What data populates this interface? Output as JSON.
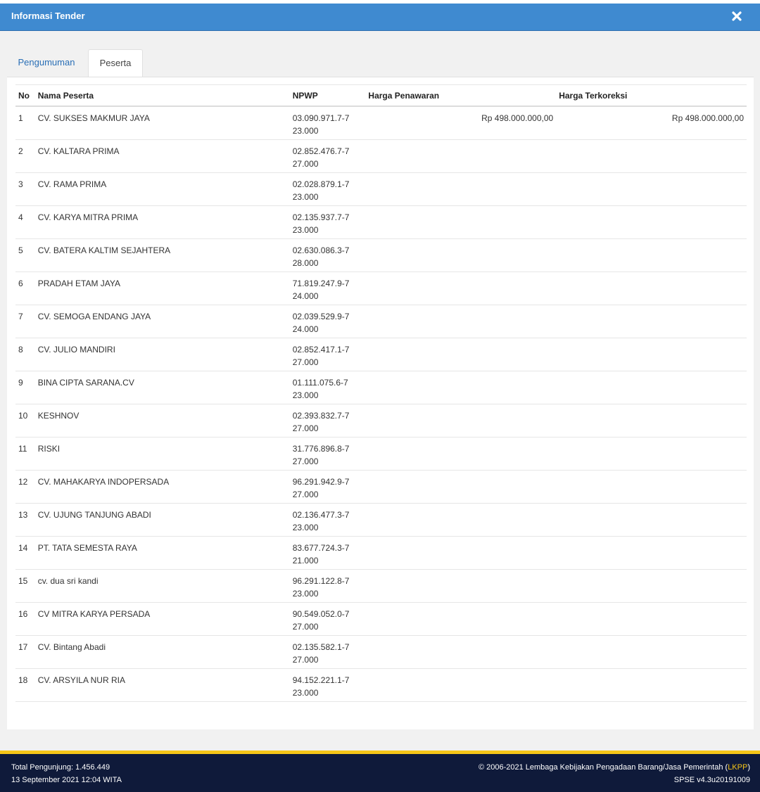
{
  "header": {
    "title": "Informasi Tender"
  },
  "tabs": [
    {
      "label": "Pengumuman",
      "active": false
    },
    {
      "label": "Peserta",
      "active": true
    }
  ],
  "table": {
    "columns": [
      "No",
      "Nama Peserta",
      "NPWP",
      "Harga Penawaran",
      "Harga Terkoreksi"
    ],
    "rows": [
      {
        "no": "1",
        "name": "CV. SUKSES MAKMUR JAYA",
        "npwp": "03.090.971.7-723.000",
        "harga": "Rp 498.000.000,00",
        "terkoreksi": "Rp 498.000.000,00"
      },
      {
        "no": "2",
        "name": "CV. KALTARA PRIMA",
        "npwp": "02.852.476.7-727.000",
        "harga": "",
        "terkoreksi": ""
      },
      {
        "no": "3",
        "name": "CV. RAMA PRIMA",
        "npwp": "02.028.879.1-723.000",
        "harga": "",
        "terkoreksi": ""
      },
      {
        "no": "4",
        "name": "CV. KARYA MITRA PRIMA",
        "npwp": "02.135.937.7-723.000",
        "harga": "",
        "terkoreksi": ""
      },
      {
        "no": "5",
        "name": "CV. BATERA KALTIM SEJAHTERA",
        "npwp": "02.630.086.3-728.000",
        "harga": "",
        "terkoreksi": ""
      },
      {
        "no": "6",
        "name": "PRADAH ETAM JAYA",
        "npwp": "71.819.247.9-724.000",
        "harga": "",
        "terkoreksi": ""
      },
      {
        "no": "7",
        "name": "CV. SEMOGA ENDANG JAYA",
        "npwp": "02.039.529.9-724.000",
        "harga": "",
        "terkoreksi": ""
      },
      {
        "no": "8",
        "name": "CV. JULIO MANDIRI",
        "npwp": "02.852.417.1-727.000",
        "harga": "",
        "terkoreksi": ""
      },
      {
        "no": "9",
        "name": "BINA CIPTA SARANA.CV",
        "npwp": "01.111.075.6-723.000",
        "harga": "",
        "terkoreksi": ""
      },
      {
        "no": "10",
        "name": "KESHNOV",
        "npwp": "02.393.832.7-727.000",
        "harga": "",
        "terkoreksi": ""
      },
      {
        "no": "11",
        "name": "RISKI",
        "npwp": "31.776.896.8-727.000",
        "harga": "",
        "terkoreksi": ""
      },
      {
        "no": "12",
        "name": "CV. MAHAKARYA INDOPERSADA",
        "npwp": "96.291.942.9-727.000",
        "harga": "",
        "terkoreksi": ""
      },
      {
        "no": "13",
        "name": "CV. UJUNG TANJUNG ABADI",
        "npwp": "02.136.477.3-723.000",
        "harga": "",
        "terkoreksi": ""
      },
      {
        "no": "14",
        "name": "PT. TATA SEMESTA RAYA",
        "npwp": "83.677.724.3-721.000",
        "harga": "",
        "terkoreksi": ""
      },
      {
        "no": "15",
        "name": "cv. dua sri kandi",
        "npwp": "96.291.122.8-723.000",
        "harga": "",
        "terkoreksi": ""
      },
      {
        "no": "16",
        "name": "CV MITRA KARYA PERSADA",
        "npwp": "90.549.052.0-727.000",
        "harga": "",
        "terkoreksi": ""
      },
      {
        "no": "17",
        "name": "CV. Bintang Abadi",
        "npwp": "02.135.582.1-727.000",
        "harga": "",
        "terkoreksi": ""
      },
      {
        "no": "18",
        "name": "CV. ARSYILA NUR RIA",
        "npwp": "94.152.221.1-723.000",
        "harga": "",
        "terkoreksi": ""
      }
    ]
  },
  "footer": {
    "visitors": "Total Pengunjung: 1.456.449",
    "datetime": "13 September 2021 12:04 WITA",
    "copyright_prefix": "© 2006-2021 Lembaga Kebijakan Pengadaan Barang/Jasa Pemerintah (",
    "copyright_link": "LKPP",
    "copyright_suffix": ")",
    "version": "SPSE v4.3u20191009"
  },
  "colors": {
    "header": "#3f8ad0",
    "footer": "#0f1a3a",
    "accent": "#f5c518",
    "link": "#2a6fb6"
  }
}
